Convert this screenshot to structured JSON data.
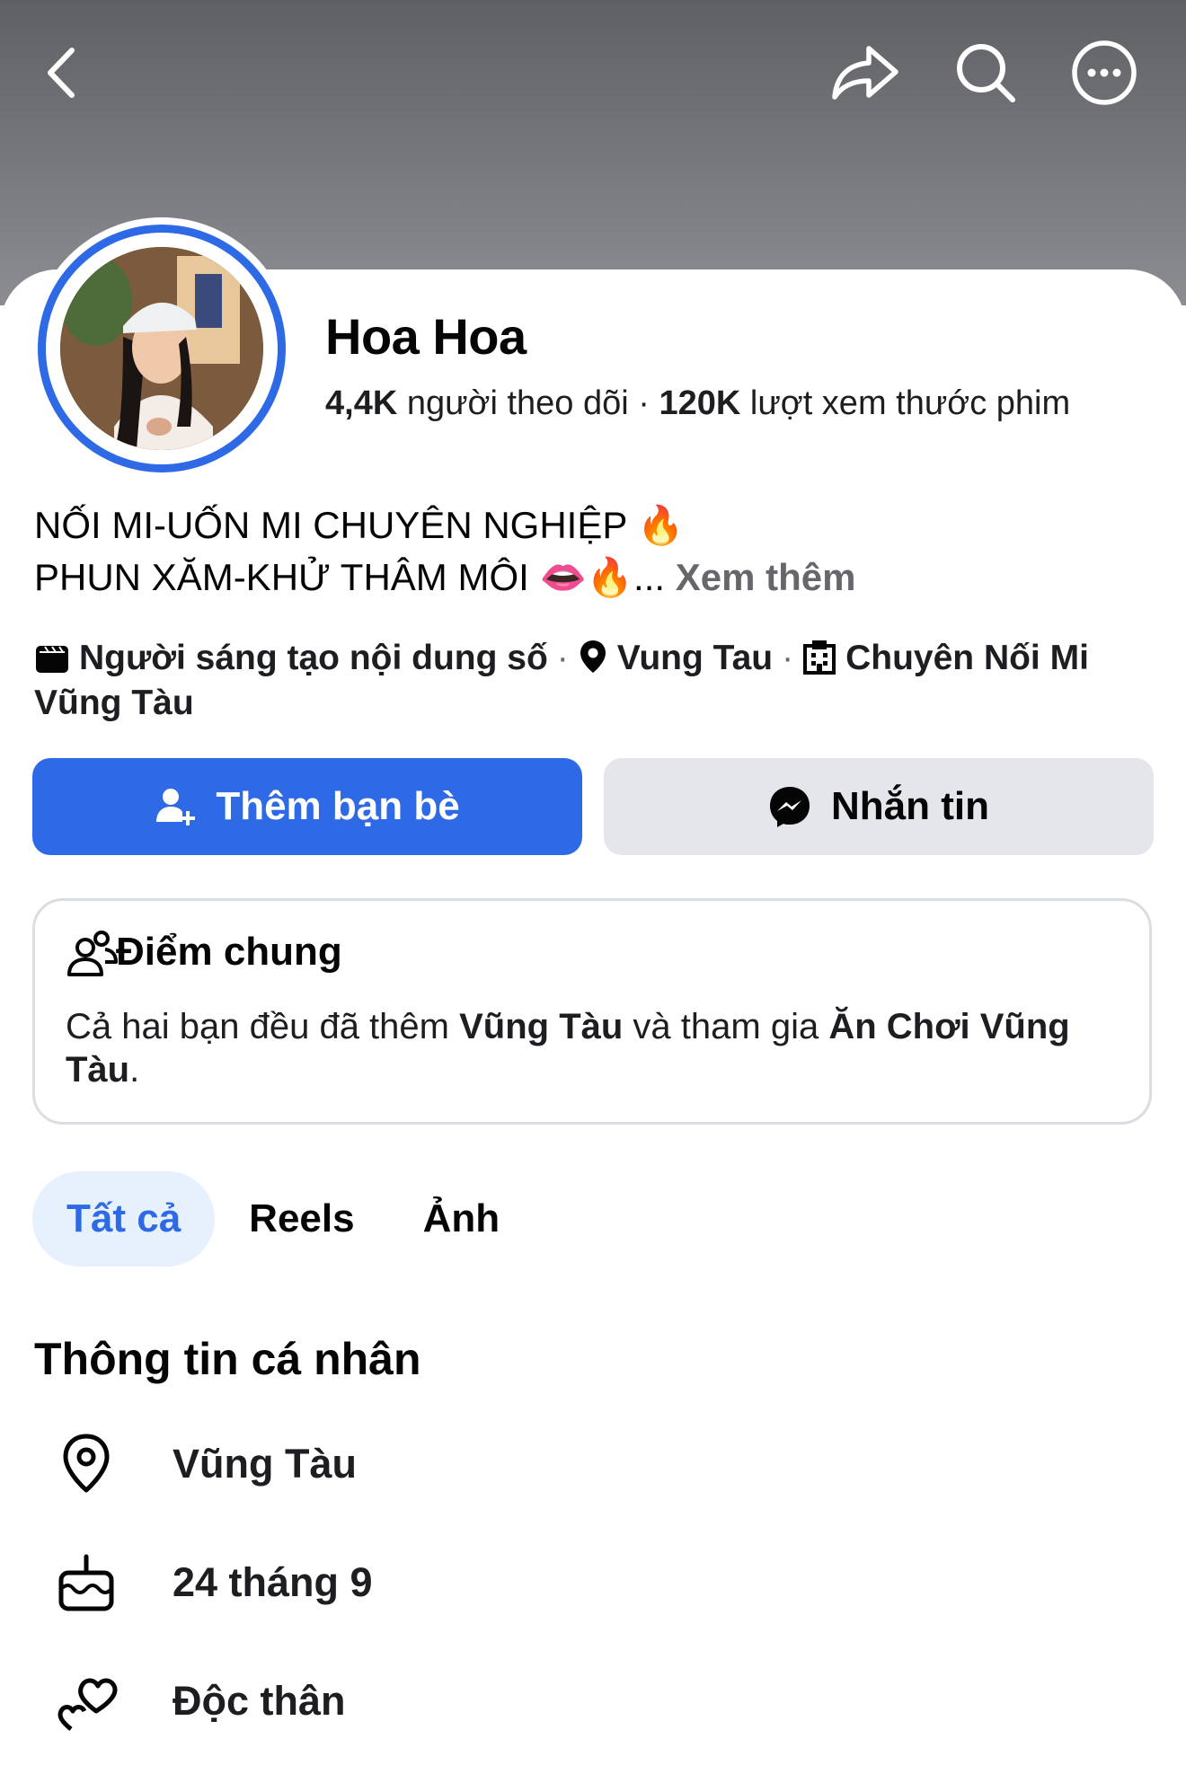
{
  "topbar": {
    "back_icon": "chevron-left-icon",
    "share_icon": "share-icon",
    "search_icon": "search-icon",
    "more_icon": "more-horizontal-icon"
  },
  "profile": {
    "name": "Hoa Hoa",
    "followers_count": "4,4K",
    "followers_label": "người theo dõi",
    "reel_views_count": "120K",
    "reel_views_label": "lượt xem thước phim",
    "bio_line1": "NỐI MI-UỐN MI CHUYÊN NGHIỆP 🔥",
    "bio_line2": "PHUN XĂM-KHỬ THÂM MÔI 👄🔥...",
    "see_more": "Xem thêm"
  },
  "meta": {
    "category": "Người sáng tạo nội dung số",
    "location": "Vung Tau",
    "business": "Chuyên Nối Mi Vũng Tàu"
  },
  "actions": {
    "add_friend": "Thêm bạn bè",
    "message": "Nhắn tin"
  },
  "common": {
    "title": "Điểm chung",
    "text_1": "Cả hai bạn đều đã thêm ",
    "place": "Vũng Tàu",
    "text_2": " và tham gia ",
    "group": "Ăn Chơi Vũng Tàu",
    "text_3": "."
  },
  "tabs": [
    "Tất cả",
    "Reels",
    "Ảnh"
  ],
  "personal_info": {
    "title": "Thông tin cá nhân",
    "items": [
      {
        "icon": "location-pin-icon",
        "text": "Vũng Tàu"
      },
      {
        "icon": "birthday-cake-icon",
        "text": "24 tháng 9"
      },
      {
        "icon": "relationship-hearts-icon",
        "text": "Độc thân"
      }
    ]
  },
  "colors": {
    "accent": "#2f6ae6",
    "tab_active_bg": "#e7f0fd",
    "secondary_button": "#e4e6eb"
  }
}
